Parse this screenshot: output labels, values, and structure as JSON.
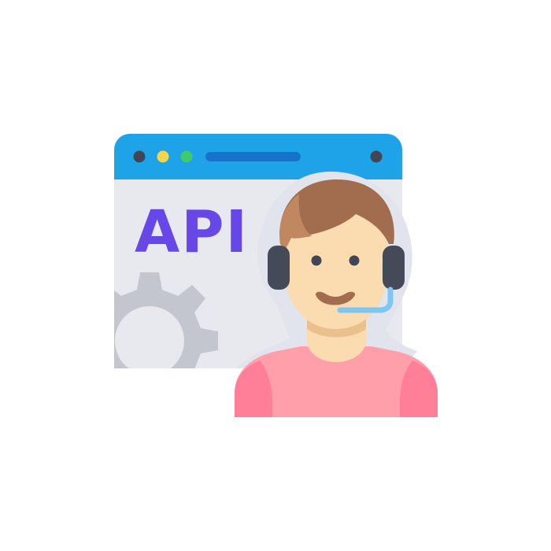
{
  "illustration": {
    "label_text": "API",
    "icons": {
      "window": "browser-window-icon",
      "gear": "gear-icon",
      "person": "support-agent-icon",
      "headset": "headset-icon"
    },
    "colors": {
      "window_bar": "#1EA3E8",
      "window_bar_slot": "#1673C9",
      "window_body": "#E8E9EE",
      "dot_dark": "#404653",
      "dot_yellow": "#F8D548",
      "dot_green": "#3FCB6A",
      "label": "#6747E8",
      "gear": "#C4C6CE",
      "skin": "#FBDCB0",
      "skin_shadow": "#EAC18D",
      "hair": "#A26D4E",
      "hair_light": "#C18760",
      "headset": "#454A58",
      "mic": "#7FC6F0",
      "shirt": "#FF9FA9",
      "shirt_side": "#FF7F98",
      "halo": "#E1E4EC"
    }
  }
}
